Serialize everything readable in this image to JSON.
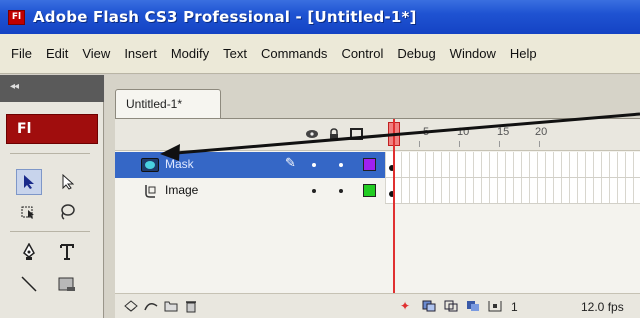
{
  "window": {
    "app_icon": "Fl",
    "title": "Adobe Flash CS3 Professional - [Untitled-1*]"
  },
  "menu": [
    "File",
    "Edit",
    "View",
    "Insert",
    "Modify",
    "Text",
    "Commands",
    "Control",
    "Debug",
    "Window",
    "Help"
  ],
  "tools_panel": {
    "grip": "◂◂",
    "badge": "Fl"
  },
  "document": {
    "tab_label": "Untitled-1*"
  },
  "timeline": {
    "ruler_labels": [
      "5",
      "10",
      "15",
      "20"
    ],
    "layers": [
      {
        "name": "Mask",
        "type": "mask",
        "selected": true,
        "color": "#a020f0"
      },
      {
        "name": "Image",
        "type": "masked",
        "selected": false,
        "color": "#22cc22"
      }
    ],
    "footer": {
      "current_frame": "1",
      "frame_rate": "12.0 fps"
    }
  },
  "colors": {
    "titlebar": "#1f53d2",
    "selection": "#3567c6",
    "playhead": "#e03030",
    "brand_red": "#a00d0d"
  }
}
